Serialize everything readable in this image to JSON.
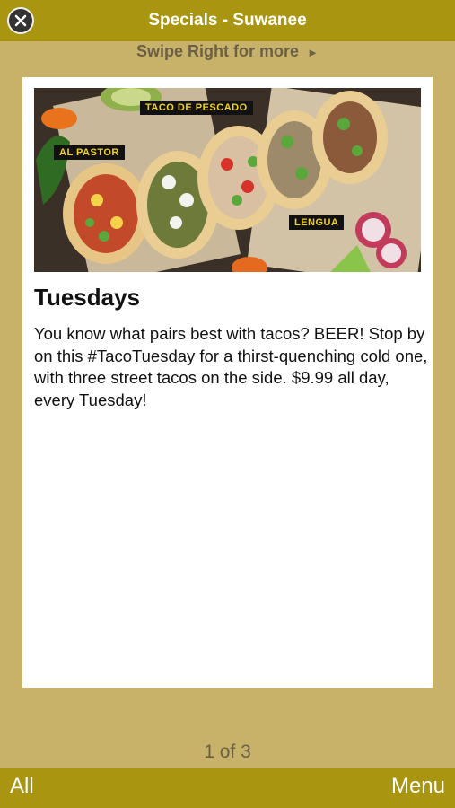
{
  "header": {
    "title": "Specials - Suwanee",
    "close_icon": "close-x-circle-icon"
  },
  "subheader": {
    "swipe_text": "Swipe Right for more",
    "arrow_glyph": "►"
  },
  "card": {
    "image_labels": {
      "pescado": "TACO DE PESCADO",
      "pastor": "AL PASTOR",
      "lengua": "LENGUA"
    },
    "title": "Tuesdays",
    "body": "You know what pairs best with tacos? BEER! Stop by on this #TacoTuesday for a thirst-quenching cold one, with three street tacos on the side. $9.99 all day, every Tuesday!"
  },
  "pager": {
    "text": "1 of 3"
  },
  "footer": {
    "left_label": "All",
    "right_label": "Menu"
  },
  "colors": {
    "bar": "#a99510",
    "background": "#c8b269",
    "label_text": "#f2d21b"
  }
}
